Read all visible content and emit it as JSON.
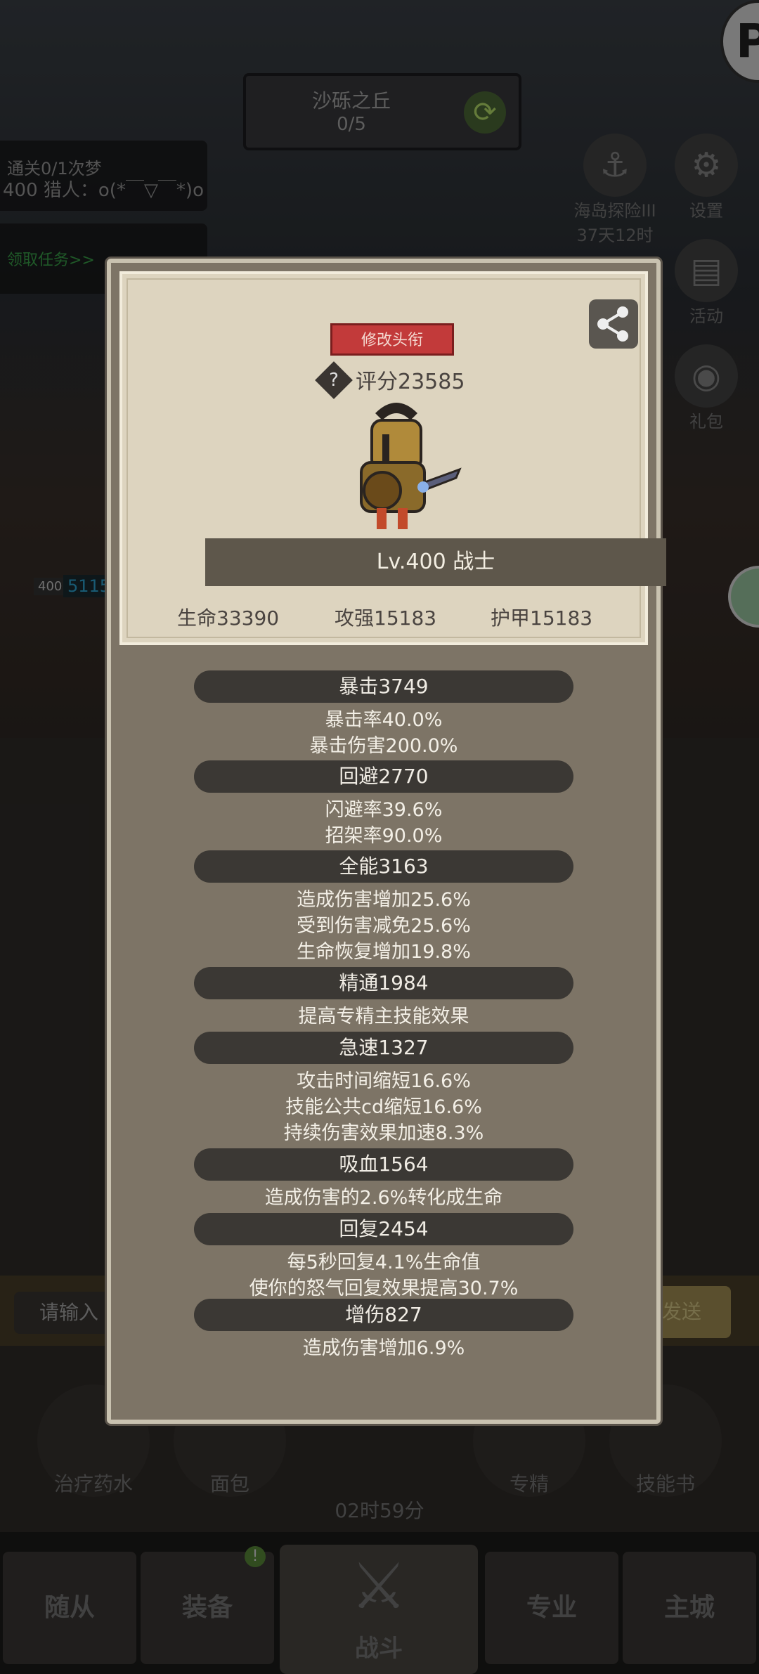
{
  "stage": {
    "name": "沙砾之丘",
    "progress": "0/5"
  },
  "quests": {
    "line1": "通关0/1次梦",
    "line2": "400 猎人：o(*￣▽￣*)o",
    "claim": "领取任务>>"
  },
  "side_menu": [
    {
      "label": "海岛探险III",
      "sub": "37天12时"
    },
    {
      "label": "设置"
    },
    {
      "label": "活动"
    },
    {
      "label": "礼包"
    }
  ],
  "player_badge": {
    "level": "400",
    "value": "5115"
  },
  "chat": {
    "placeholder": "请输入",
    "send": "发送"
  },
  "items": [
    {
      "label": "治疗药水"
    },
    {
      "label": "面包"
    },
    {
      "label": "专精"
    },
    {
      "label": "技能书"
    }
  ],
  "item_timer": "02时59分",
  "nav": {
    "followers": "随从",
    "equipment": "装备",
    "battle": "战斗",
    "profession": "专业",
    "main_city": "主城",
    "equip_badge": "!"
  },
  "dialog": {
    "title_button": "修改头衔",
    "help_glyph": "?",
    "score": "评分23585",
    "level_class": "Lv.400 战士",
    "base_stats": {
      "hp": "生命33390",
      "attack": "攻强15183",
      "armor": "护甲15183"
    },
    "stats": [
      {
        "header": "暴击3749",
        "lines": [
          "暴击率40.0%",
          "暴击伤害200.0%"
        ]
      },
      {
        "header": "回避2770",
        "lines": [
          "闪避率39.6%",
          "招架率90.0%"
        ]
      },
      {
        "header": "全能3163",
        "lines": [
          "造成伤害增加25.6%",
          "受到伤害减免25.6%",
          "生命恢复增加19.8%"
        ]
      },
      {
        "header": "精通1984",
        "lines": [
          "提高专精主技能效果"
        ]
      },
      {
        "header": "急速1327",
        "lines": [
          "攻击时间缩短16.6%",
          "技能公共cd缩短16.6%",
          "持续伤害效果加速8.3%"
        ]
      },
      {
        "header": "吸血1564",
        "lines": [
          "造成伤害的2.6%转化成生命"
        ]
      },
      {
        "header": "回复2454",
        "lines": [
          "每5秒回复4.1%生命值",
          "使你的怒气回复效果提高30.7%"
        ]
      },
      {
        "header": "增伤827",
        "lines": [
          "造成伤害增加6.9%"
        ]
      }
    ]
  }
}
